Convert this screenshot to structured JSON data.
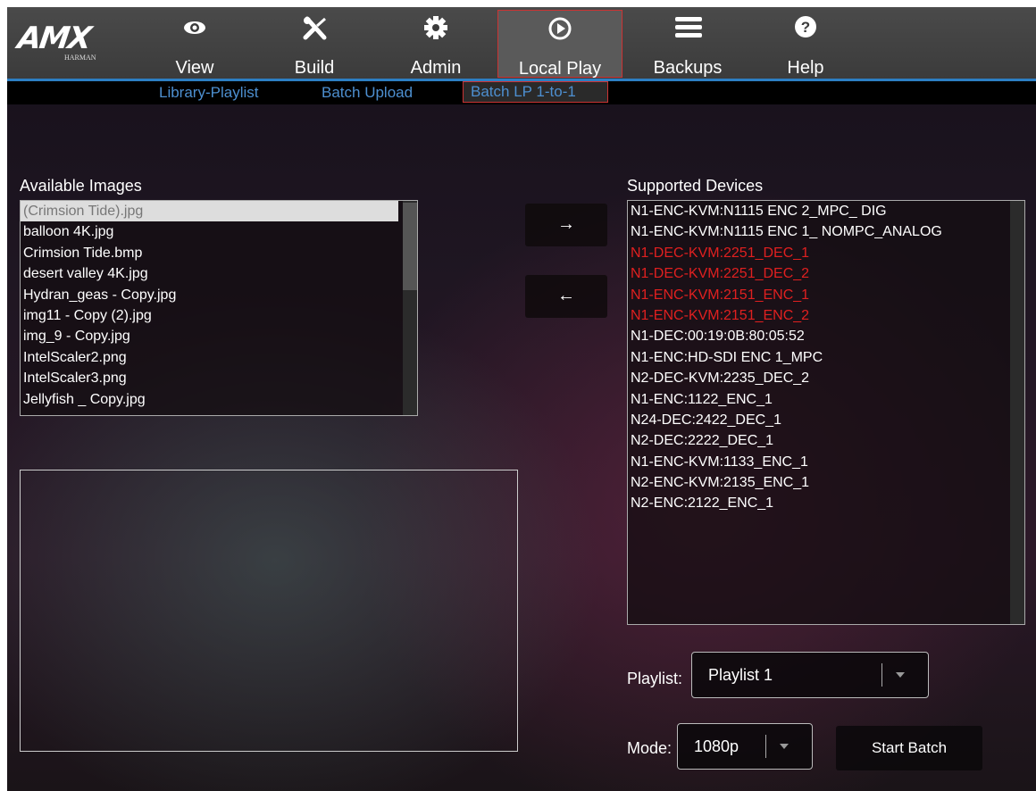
{
  "logo": {
    "brand": "AMX",
    "sub": "HARMAN"
  },
  "nav": [
    {
      "label": "View",
      "icon": "eye-icon"
    },
    {
      "label": "Build",
      "icon": "tools-icon"
    },
    {
      "label": "Admin",
      "icon": "gear-icon"
    },
    {
      "label": "Local Play",
      "icon": "play-circle-icon"
    },
    {
      "label": "Backups",
      "icon": "hamburger-icon"
    },
    {
      "label": "Help",
      "icon": "question-icon"
    }
  ],
  "subnav": [
    {
      "label": "Library-Playlist"
    },
    {
      "label": "Batch Upload"
    },
    {
      "label": "Batch LP 1-to-1"
    }
  ],
  "available_images": {
    "title": "Available Images",
    "items": [
      "(Crimsion Tide).jpg",
      "balloon 4K.jpg",
      "Crimsion Tide.bmp",
      "desert valley 4K.jpg",
      "Hydran_geas - Copy.jpg",
      "img11 - Copy (2).jpg",
      "img_9 - Copy.jpg",
      "IntelScaler2.png",
      "IntelScaler3.png",
      "Jellyfish _ Copy.jpg"
    ]
  },
  "arrows": {
    "right": "→",
    "left": "←"
  },
  "supported_devices": {
    "title": "Supported Devices",
    "items": [
      "N1-ENC-KVM:N1115 ENC 2_MPC_ DIG",
      "N1-ENC-KVM:N1115 ENC 1_ NOMPC_ANALOG",
      "N1-DEC-KVM:2251_DEC_1",
      "N1-DEC-KVM:2251_DEC_2",
      "N1-ENC-KVM:2151_ENC_1",
      "N1-ENC-KVM:2151_ENC_2",
      "N1-DEC:00:19:0B:80:05:52",
      "N1-ENC:HD-SDI ENC 1_MPC",
      "N2-DEC-KVM:2235_DEC_2",
      "N1-ENC:1122_ENC_1",
      "N24-DEC:2422_DEC_1",
      "N2-DEC:2222_DEC_1",
      "N1-ENC-KVM:1133_ENC_1",
      "N2-ENC-KVM:2135_ENC_1",
      "N2-ENC:2122_ENC_1"
    ]
  },
  "playlist": {
    "label": "Playlist:",
    "value": "Playlist 1"
  },
  "mode": {
    "label": "Mode:",
    "value": "1080p"
  },
  "start_batch": "Start Batch",
  "colors": {
    "accent": "#2d7fc3",
    "active_border": "#cc3333",
    "highlight_red": "#e02020"
  }
}
